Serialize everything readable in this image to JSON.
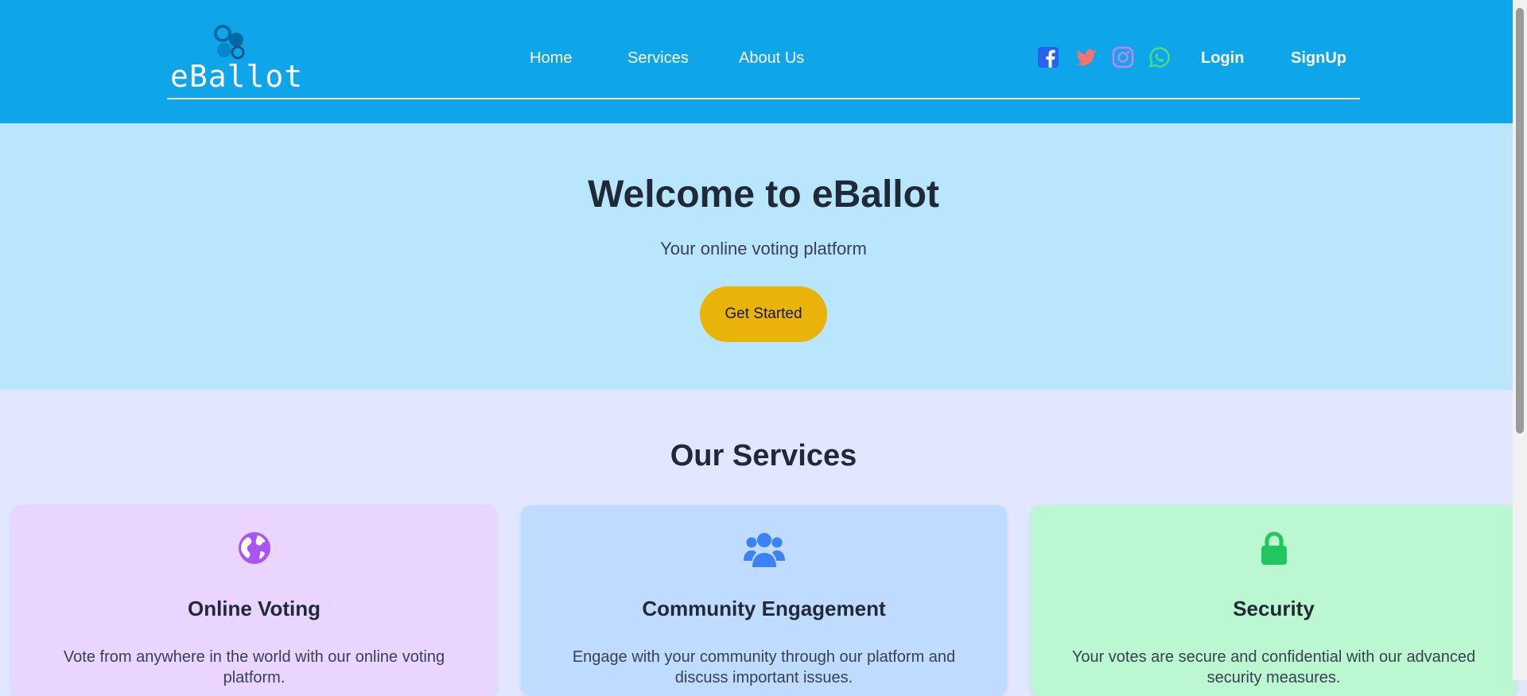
{
  "header": {
    "logo_text": "eBallot",
    "nav": [
      "Home",
      "Services",
      "About Us"
    ],
    "social": [
      "facebook-icon",
      "twitter-icon",
      "instagram-icon",
      "whatsapp-icon"
    ],
    "login_label": "Login",
    "signup_label": "SignUp",
    "colors": {
      "background": "#0ea5e9",
      "facebook": "#2563eb",
      "twitter": "#f87171",
      "instagram": "#c084fc",
      "whatsapp": "#4ade80"
    }
  },
  "hero": {
    "title": "Welcome to eBallot",
    "subtitle": "Your online voting platform",
    "cta_label": "Get Started",
    "colors": {
      "background": "#bae6fd",
      "cta": "#eab308"
    }
  },
  "services": {
    "title": "Our Services",
    "cards": [
      {
        "icon": "globe-icon",
        "title": "Online Voting",
        "text": "Vote from anywhere in the world with our online voting platform.",
        "color": "#e9d5ff",
        "icon_color": "#a855f7"
      },
      {
        "icon": "users-icon",
        "title": "Community Engagement",
        "text": "Engage with your community through our platform and discuss important issues.",
        "color": "#bfdbfe",
        "icon_color": "#3b82f6"
      },
      {
        "icon": "lock-icon",
        "title": "Security",
        "text": "Your votes are secure and confidential with our advanced security measures.",
        "color": "#bbf7d0",
        "icon_color": "#22c55e"
      }
    ]
  }
}
